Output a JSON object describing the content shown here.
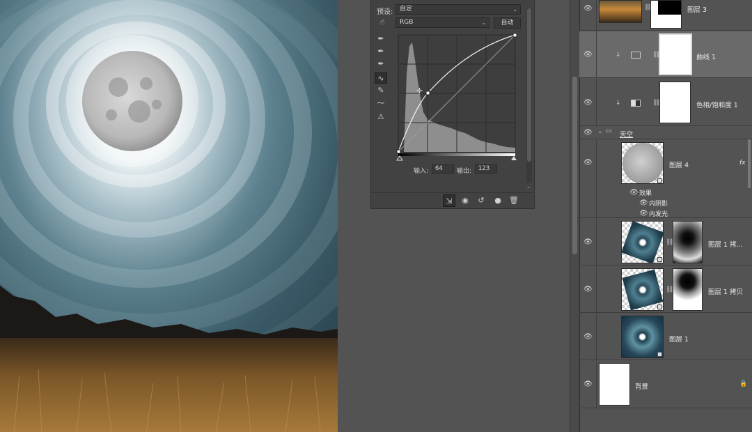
{
  "curves": {
    "preset_label": "预设:",
    "preset_value": "自定",
    "channel_value": "RGB",
    "auto_label": "自动",
    "input_label": "输入:",
    "input_value": "64",
    "output_label": "输出:",
    "output_value": "123"
  },
  "tools": [
    "eyedropper-black-icon",
    "eyedropper-gray-icon",
    "eyedropper-white-icon",
    "curve-point-icon",
    "pencil-icon",
    "smooth-icon",
    "clipping-warning-icon"
  ],
  "panel_bottom_icons": [
    "clip-to-layer-icon",
    "view-previous-icon",
    "reset-icon",
    "visibility-icon",
    "trash-icon"
  ],
  "layers": {
    "items": [
      {
        "name": "图层 3",
        "type": "pixel",
        "visible": true
      },
      {
        "name": "曲线 1",
        "type": "curves-adjustment",
        "visible": true,
        "selected": true
      },
      {
        "name": "色相/饱和度 1",
        "type": "hue-saturation-adjustment",
        "visible": true
      },
      {
        "name": "天空",
        "type": "group",
        "visible": true
      },
      {
        "name": "图层 4",
        "type": "pixel",
        "visible": true,
        "fx": "fx"
      },
      {
        "name": "图层 1 拷...",
        "type": "pixel-mask",
        "visible": true
      },
      {
        "name": "图层 1 拷贝",
        "type": "pixel-mask",
        "visible": true
      },
      {
        "name": "图层 1",
        "type": "pixel",
        "visible": true
      },
      {
        "name": "背景",
        "type": "background",
        "visible": true,
        "locked": true
      }
    ],
    "effects_label": "效果",
    "effect_items": [
      "内阴影",
      "内发光"
    ]
  },
  "colors": {
    "panel_bg": "#535353",
    "panel_dark": "#424242",
    "selected_layer": "#6a6a6a",
    "text": "#e8e8e8"
  }
}
